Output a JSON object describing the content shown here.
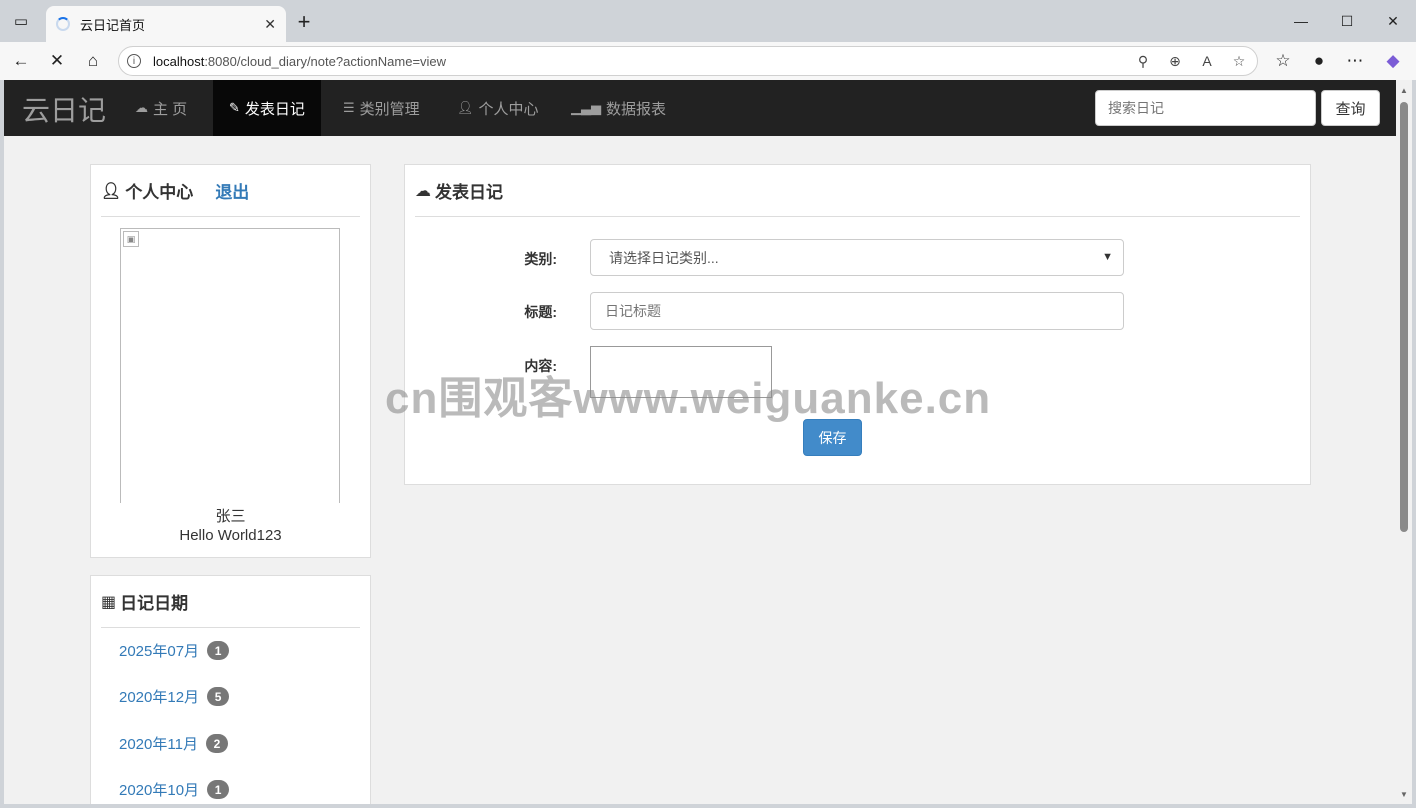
{
  "browser": {
    "tab_title": "云日记首页",
    "url_host": "localhost",
    "url_rest": ":8080/cloud_diary/note?actionName=view"
  },
  "navbar": {
    "brand": "云日记",
    "items": [
      {
        "label": "主 页",
        "icon": "cloud-icon"
      },
      {
        "label": "发表日记",
        "icon": "pencil-icon",
        "active": true
      },
      {
        "label": "类别管理",
        "icon": "list-icon"
      },
      {
        "label": "个人中心",
        "icon": "user-icon"
      },
      {
        "label": "数据报表",
        "icon": "bar-chart-icon"
      }
    ],
    "search_placeholder": "搜索日记",
    "search_button": "查询"
  },
  "profile": {
    "title": "个人中心",
    "logout": "退出",
    "name": "张三",
    "mood": "Hello World123"
  },
  "dates": {
    "title": "日记日期",
    "items": [
      {
        "label": "2025年07月",
        "count": "1"
      },
      {
        "label": "2020年12月",
        "count": "5"
      },
      {
        "label": "2020年11月",
        "count": "2"
      },
      {
        "label": "2020年10月",
        "count": "1"
      }
    ]
  },
  "editor": {
    "title": "发表日记",
    "category_label": "类别:",
    "category_placeholder": "请选择日记类别...",
    "title_label": "标题:",
    "title_placeholder": "日记标题",
    "content_label": "内容:",
    "save": "保存"
  },
  "watermark": "cn围观客www.weiguanke.cn",
  "colors": {
    "navbar_bg": "#222222",
    "link": "#337ab7",
    "primary_button": "#428bca",
    "badge": "#777777"
  }
}
